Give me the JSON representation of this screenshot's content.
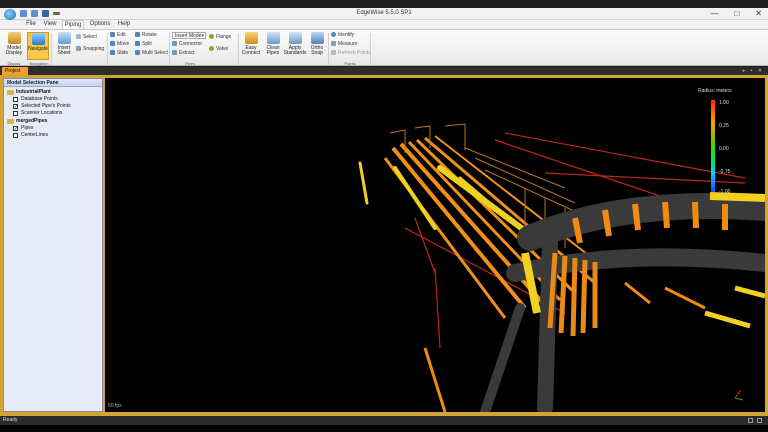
{
  "window": {
    "title": "EdgeWise 5.5.0 SP1",
    "controls": [
      "—",
      "□",
      "✕"
    ]
  },
  "menu": {
    "tabs": [
      "File",
      "View",
      "Piping",
      "Options",
      "Help"
    ],
    "active": "Piping"
  },
  "ribbon": {
    "model_display": "Model\nDisplay",
    "navigate": "Navigate",
    "insert_sheet": "Insert\nSheet",
    "select": "Select",
    "snapping": "Snapping",
    "edit": "Edit",
    "move": "Move",
    "slide": "Slide",
    "rotate": "Rotate",
    "split": "Split",
    "multi_select": "Multi Select",
    "insert_mode": "Insert Mode",
    "connector": "Connector",
    "extract": "Extract",
    "flange": "Flange",
    "valve": "Valve",
    "easy_connect": "Easy\nConnect",
    "clean_pipes": "Clean\nPipes",
    "apply_standards": "Apply\nStandards",
    "ortho_snap": "Ortho\nSnap",
    "identify": "Identify",
    "measure": "Measure",
    "refresh_points": "Refresh Points",
    "groups": {
      "display": "Display",
      "navigation": "Navigation",
      "pipes": "Pipes",
      "points": "Points"
    }
  },
  "project_tab": "Project",
  "pane": {
    "title": "Model Selection Pane",
    "groups": [
      {
        "name": "IndustrialPlant",
        "items": [
          {
            "label": "Database Points",
            "checked": false
          },
          {
            "label": "Selected Pipe's Points",
            "checked": true
          },
          {
            "label": "Scanner Locations",
            "checked": false
          }
        ]
      },
      {
        "name": "mergedPipes",
        "items": [
          {
            "label": "Pipes",
            "checked": true
          },
          {
            "label": "CenterLines",
            "checked": false
          }
        ]
      }
    ]
  },
  "color_scale": {
    "title": "Radius: meters",
    "labels": [
      "1.00",
      "0.25",
      "0.00",
      "-0.75",
      "-1.00"
    ],
    "colors": [
      "#ff2a00",
      "#ffa000",
      "#20e000",
      "#00d0ff",
      "#2040ff"
    ]
  },
  "viewport": {
    "fps": "60 fps"
  },
  "status": {
    "text": "Ready"
  },
  "colors": {
    "accent": "#f0a030",
    "pipe_yellow": "#f0d020",
    "pipe_orange": "#f08a10",
    "pipe_gray": "#3a3a3a"
  }
}
